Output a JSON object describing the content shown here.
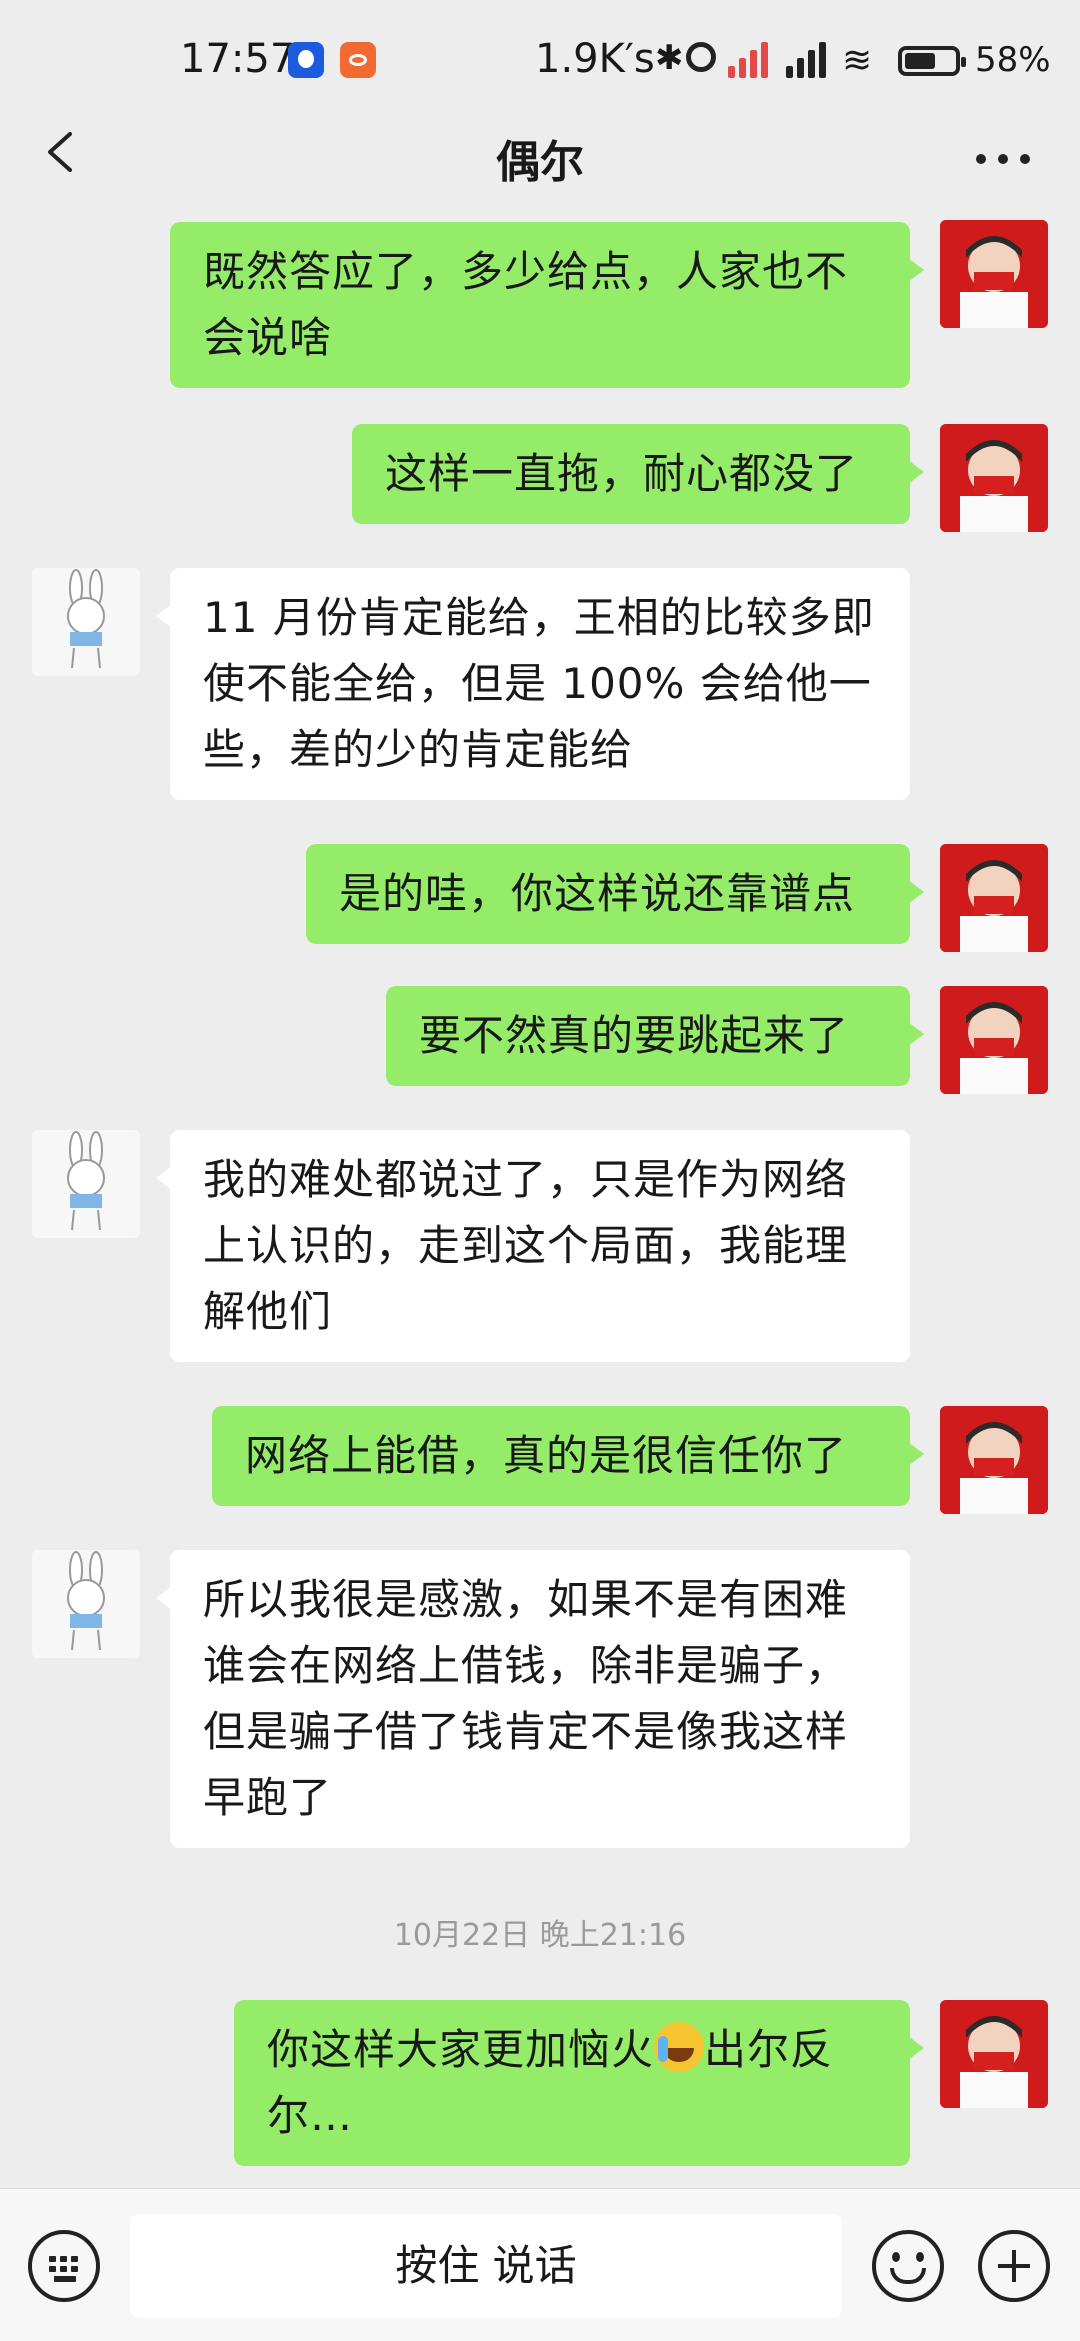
{
  "status_bar": {
    "time": "17:57",
    "network_speed": "1.9K′s",
    "battery": "58%",
    "icons": [
      "app-notification-icon",
      "bike-app-icon",
      "bluetooth-icon",
      "alarm-icon",
      "signal-icon",
      "wifi-icon",
      "battery-icon"
    ]
  },
  "header": {
    "title": "偶尔",
    "back_icon": "chevron-left-icon",
    "more_icon": "more-dots-icon"
  },
  "messages": [
    {
      "from": "me",
      "lines": [
        "既然答应了，多少给点，人家也不",
        "会说啥"
      ]
    },
    {
      "from": "me",
      "lines": [
        "这样一直拖，耐心都没了"
      ]
    },
    {
      "from": "other",
      "lines": [
        "11 月份肯定能给，王相的比较多即",
        "使不能全给，但是 100% 会给他一",
        "些，差的少的肯定能给"
      ]
    },
    {
      "from": "me",
      "lines": [
        "是的哇，你这样说还靠谱点"
      ]
    },
    {
      "from": "me",
      "lines": [
        "要不然真的要跳起来了"
      ]
    },
    {
      "from": "other",
      "lines": [
        "我的难处都说过了，只是作为网络",
        "上认识的，走到这个局面，我能理",
        "解他们"
      ]
    },
    {
      "from": "me",
      "lines": [
        "网络上能借，真的是很信任你了"
      ]
    },
    {
      "from": "other",
      "lines": [
        "所以我很是感激，如果不是有困难",
        "谁会在网络上借钱，除非是骗子，",
        "但是骗子借了钱肯定不是像我这样",
        "早跑了"
      ]
    },
    {
      "from": "me",
      "line1_before": "你这样大家更加恼火",
      "emoji": "loudly-crying-emoji",
      "line1_after": "出尔反",
      "line2": "尔…"
    }
  ],
  "timestamp": "10月22日 晚上21:16",
  "input_bar": {
    "hold_to_talk": "按住 说话",
    "icons": [
      "keyboard-icon",
      "emoji-icon",
      "plus-icon"
    ]
  },
  "colors": {
    "background": "#ededed",
    "my_bubble": "#95ec69",
    "other_bubble": "#ffffff",
    "my_avatar": "#cf1b1b"
  }
}
